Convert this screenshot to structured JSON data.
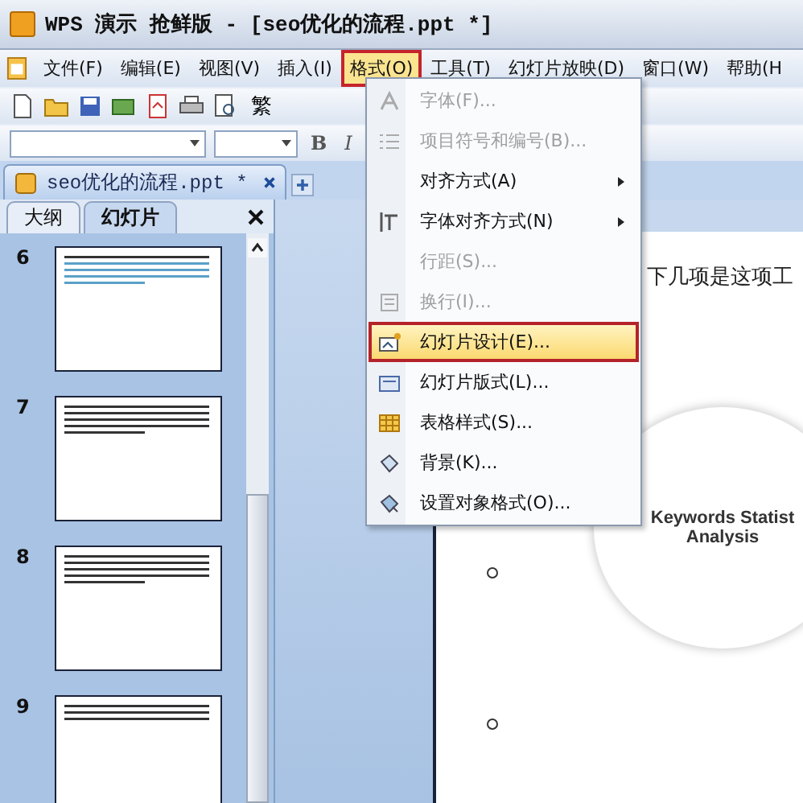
{
  "window": {
    "title": "WPS 演示 抢鲜版 - [seo优化的流程.ppt *]"
  },
  "menu_bar": [
    {
      "label": "文件(F)",
      "selected": false
    },
    {
      "label": "编辑(E)",
      "selected": false
    },
    {
      "label": "视图(V)",
      "selected": false
    },
    {
      "label": "插入(I)",
      "selected": false
    },
    {
      "label": "格式(O)",
      "selected": true
    },
    {
      "label": "工具(T)",
      "selected": false
    },
    {
      "label": "幻灯片放映(D)",
      "selected": false
    },
    {
      "label": "窗口(W)",
      "selected": false
    },
    {
      "label": "帮助(H",
      "selected": false
    }
  ],
  "toolbar": {
    "traditional_button": "繁",
    "bold_button": "B",
    "italic_button": "I"
  },
  "document_tab": {
    "label": "seo优化的流程.ppt *"
  },
  "panel_tabs": [
    {
      "label": "大纲",
      "selected": false
    },
    {
      "label": "幻灯片",
      "selected": true
    }
  ],
  "slides": [
    {
      "number": "6"
    },
    {
      "number": "7"
    },
    {
      "number": "8"
    },
    {
      "number": "9"
    }
  ],
  "format_menu": [
    {
      "label": "字体(F)...",
      "disabled": true,
      "submenu": false,
      "selected": false
    },
    {
      "label": "项目符号和编号(B)...",
      "disabled": true,
      "submenu": false,
      "selected": false
    },
    {
      "label": "对齐方式(A)",
      "disabled": false,
      "submenu": true,
      "selected": false
    },
    {
      "label": "字体对齐方式(N)",
      "disabled": false,
      "submenu": true,
      "selected": false
    },
    {
      "label": "行距(S)...",
      "disabled": true,
      "submenu": false,
      "selected": false
    },
    {
      "label": "换行(I)...",
      "disabled": true,
      "submenu": false,
      "selected": false
    },
    {
      "label": "幻灯片设计(E)...",
      "disabled": false,
      "submenu": false,
      "selected": true
    },
    {
      "label": "幻灯片版式(L)...",
      "disabled": false,
      "submenu": false,
      "selected": false
    },
    {
      "label": "表格样式(S)...",
      "disabled": false,
      "submenu": false,
      "selected": false
    },
    {
      "label": "背景(K)...",
      "disabled": false,
      "submenu": false,
      "selected": false
    },
    {
      "label": "设置对象格式(O)...",
      "disabled": false,
      "submenu": false,
      "selected": false
    }
  ],
  "slide": {
    "body_text": "下几项是这项工",
    "circle_text": [
      "Keywords Statist",
      "Analysis"
    ]
  }
}
